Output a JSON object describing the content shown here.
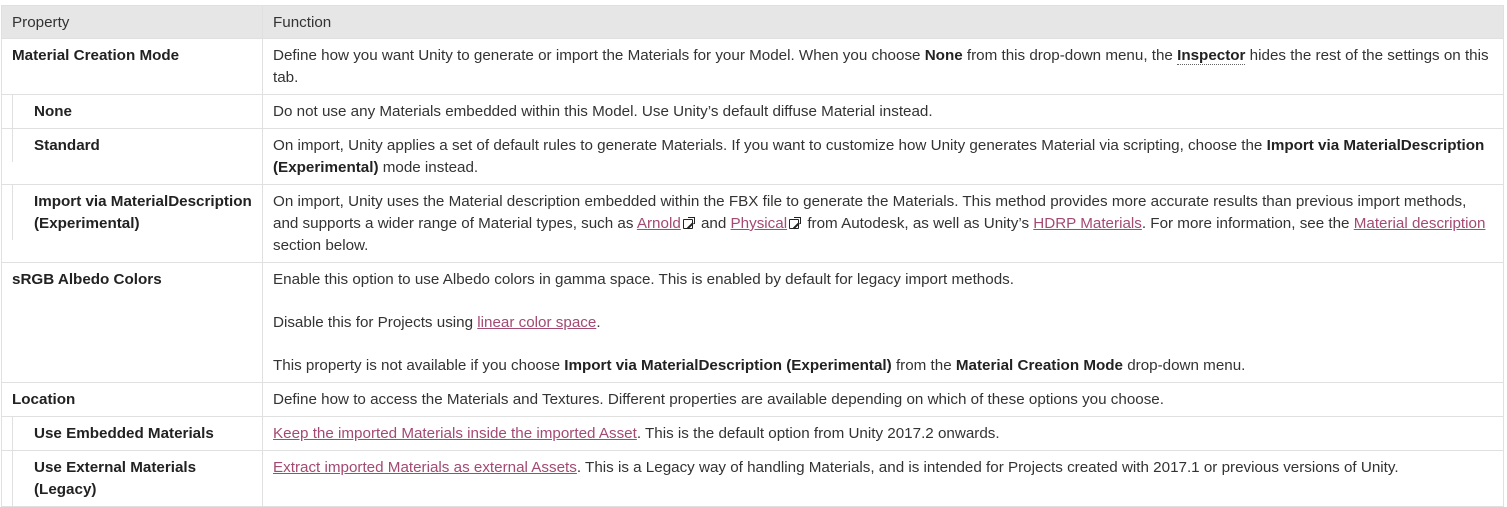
{
  "header": {
    "property": "Property",
    "function": "Function"
  },
  "rows": {
    "material_creation_mode": {
      "name": "Material Creation Mode",
      "t1": "Define how you want Unity to generate or import the Materials for your Model. When you choose ",
      "b1": "None",
      "t2": " from this drop-down menu, the ",
      "b2": "Inspector",
      "t3": " hides the rest of the settings on this tab."
    },
    "none": {
      "name": "None",
      "t1": "Do not use any Materials embedded within this Model. Use Unity’s default diffuse Material instead."
    },
    "standard": {
      "name": "Standard",
      "t1": "On import, Unity applies a set of default rules to generate Materials. If you want to customize how Unity generates Material via scripting, choose the ",
      "b1": "Import via MaterialDescription (Experimental)",
      "t2": " mode instead."
    },
    "import_via": {
      "name": "Import via MaterialDescription (Experimental)",
      "t1": "On import, Unity uses the Material description embedded within the FBX file to generate the Materials. This method provides more accurate results than previous import methods, and supports a wider range of Material types, such as ",
      "l1": "Arnold",
      "t2": " and ",
      "l2": "Physical",
      "t3": " from Autodesk, as well as Unity’s ",
      "l3": "HDRP Materials",
      "t4": ". For more information, see the ",
      "l4": "Material description",
      "t5": " section below."
    },
    "srgb": {
      "name": "sRGB Albedo Colors",
      "p1": "Enable this option to use Albedo colors in gamma space. This is enabled by default for legacy import methods.",
      "p2a": "Disable this for Projects using ",
      "p2l": "linear color space",
      "p2b": ".",
      "p3a": "This property is not available if you choose ",
      "p3b1": "Import via MaterialDescription (Experimental)",
      "p3c": " from the ",
      "p3b2": "Material Creation Mode",
      "p3d": " drop-down menu."
    },
    "location": {
      "name": "Location",
      "t1": "Define how to access the Materials and Textures. Different properties are available depending on which of these options you choose."
    },
    "use_embedded": {
      "name": "Use Embedded Materials",
      "l1": "Keep the imported Materials inside the imported Asset",
      "t1": ". This is the default option from Unity 2017.2 onwards."
    },
    "use_external": {
      "name": "Use External Materials (Legacy)",
      "l1": "Extract imported Materials as external Assets",
      "t1": ". This is a Legacy way of handling Materials, and is intended for Projects created with 2017.1 or previous versions of Unity."
    }
  },
  "icons": {
    "external_link": "external-link-icon"
  },
  "colors": {
    "link": "#a34a73",
    "header_bg": "#e6e6e6",
    "border": "#e0e0e0"
  }
}
